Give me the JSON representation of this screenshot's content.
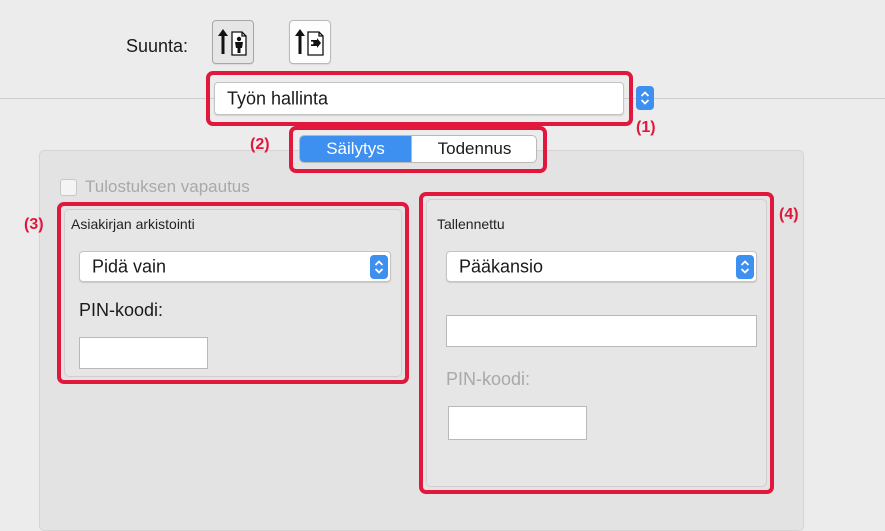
{
  "orientation": {
    "label": "Suunta:",
    "options": [
      {
        "name": "portrait",
        "selected": true
      },
      {
        "name": "landscape",
        "selected": false
      }
    ]
  },
  "job_menu": {
    "value": "Työn hallinta",
    "callout": "(1)"
  },
  "tabs": {
    "callout": "(2)",
    "items": [
      {
        "label": "Säilytys",
        "selected": true
      },
      {
        "label": "Todennus",
        "selected": false
      }
    ]
  },
  "release": {
    "label": "Tulostuksen vapautus",
    "checked": false,
    "enabled": false
  },
  "document_filing": {
    "callout": "(3)",
    "title": "Asiakirjan arkistointi",
    "mode_value": "Pidä vain",
    "pin_label": "PIN-koodi:",
    "pin_value": ""
  },
  "stored": {
    "callout": "(4)",
    "title": "Tallennettu",
    "folder_value": "Pääkansio",
    "name_value": "",
    "pin_label": "PIN-koodi:",
    "pin_value": ""
  },
  "colors": {
    "accent": "#3d8ff0",
    "highlight": "#e2173d",
    "panel": "#e3e3e3"
  }
}
